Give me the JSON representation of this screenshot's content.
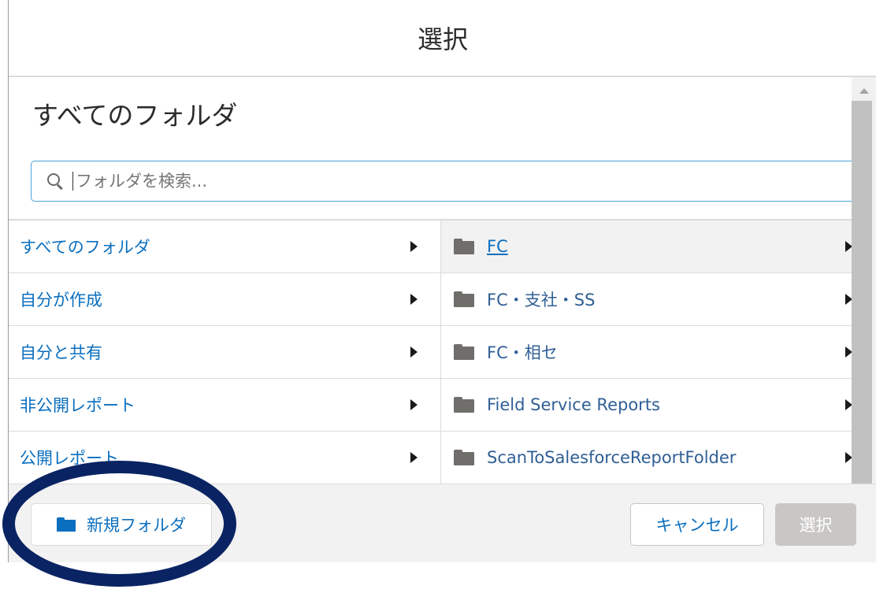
{
  "modal": {
    "title": "選択",
    "section_title": "すべてのフォルダ",
    "search": {
      "placeholder": "フォルダを検索..."
    },
    "left_items": [
      {
        "label": "すべてのフォルダ"
      },
      {
        "label": "自分が作成"
      },
      {
        "label": "自分と共有"
      },
      {
        "label": "非公開レポート"
      },
      {
        "label": "公開レポート"
      }
    ],
    "right_items": [
      {
        "label": "FC",
        "icon": "folder-icon",
        "active": true
      },
      {
        "label": "FC・支社・SS",
        "icon": "folder-icon"
      },
      {
        "label": "FC・相セ",
        "icon": "folder-icon"
      },
      {
        "label": "Field Service Reports",
        "icon": "folder-icon"
      },
      {
        "label": "ScanToSalesforceReportFolder",
        "icon": "folder-icon"
      }
    ],
    "footer": {
      "new_folder_label": "新規フォルダ",
      "cancel_label": "キャンセル",
      "select_label": "選択"
    }
  },
  "colors": {
    "link": "#0b6fbf",
    "annotation": "#0a2463",
    "disabled_button": "#c9c7c5"
  }
}
